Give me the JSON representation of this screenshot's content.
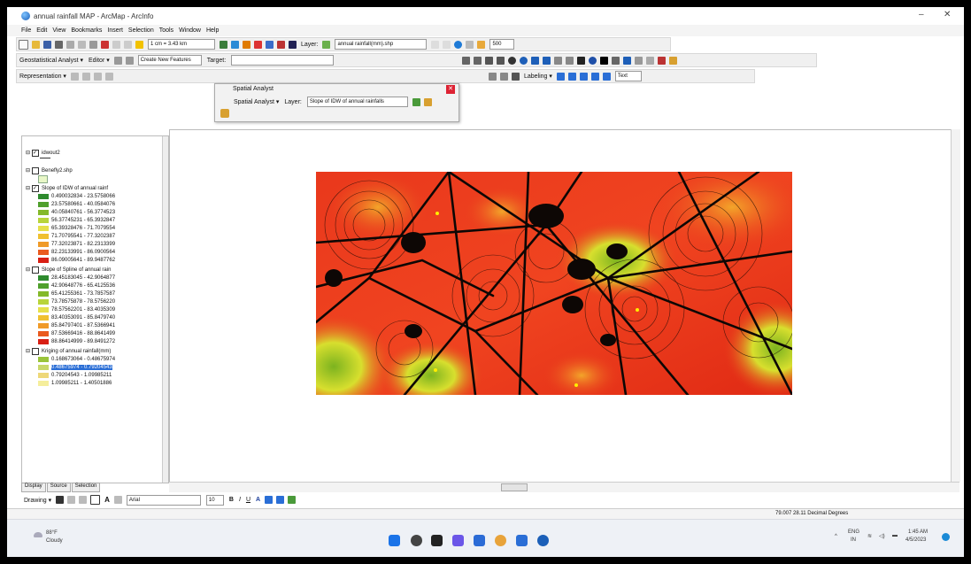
{
  "window": {
    "title": "annual rainfall MAP - ArcMap - ArcInfo",
    "minimize": "–",
    "close": "✕"
  },
  "menu": [
    "File",
    "Edit",
    "View",
    "Bookmarks",
    "Insert",
    "Selection",
    "Tools",
    "Window",
    "Help"
  ],
  "toolbar1": {
    "scale": "1 cm = 3.43 km",
    "layer_label": "Layer:",
    "layer_value": "annual rainfall(mm).shp",
    "zoom_value": "500"
  },
  "toolbar2": {
    "geostat_label": "Geostatistical Analyst ▾",
    "editor_label": "Editor ▾",
    "create_features": "Create New Features",
    "target": "Target:"
  },
  "toolbar3": {
    "representation_label": "Representation ▾",
    "labeling_label": "Labeling ▾",
    "font_value": "Text"
  },
  "spatial_analyst": {
    "title": "Spatial Analyst",
    "menu_label": "Spatial Analyst ▾",
    "layer_label": "Layer:",
    "layer_value": "Slope of IDW of annual rainfalls"
  },
  "toc": {
    "layers": [
      {
        "name": "idwout2",
        "checked": true
      },
      {
        "name": "Benefly2.shp",
        "checked": false
      },
      {
        "name": "Slope of IDW of annual rainf",
        "checked": true,
        "classes": [
          "0.490032834 - 23.5758066",
          "23.57580661 - 40.0584076",
          "40.05840761 - 56.3774523",
          "56.37745231 - 65.3932847",
          "65.39328476 - 71.7079554",
          "71.70795541 - 77.3202387",
          "77.32023871 - 82.2313399",
          "82.23133991 - 86.0900564",
          "86.09005641 - 89.9487762"
        ]
      },
      {
        "name": "Slope of Spline of annual rain",
        "checked": false,
        "classes": [
          "28.45183045 - 42.9064877",
          "42.90648776 - 65.4125536",
          "65.41255361 - 73.7857587",
          "73.78575878 - 78.5756220",
          "78.57562201 - 83.4035309",
          "83.40353091 - 85.8479740",
          "85.84797401 - 87.5366941",
          "87.53669416 - 88.8641499",
          "88.86414999 - 89.8491272"
        ]
      },
      {
        "name": "Kriging of annual rainfall(mm)",
        "checked": false,
        "classes": [
          "0.168673064 - 0.48675974",
          "0.48675974 - 0.79204543",
          "0.79204543 - 1.09985211",
          "1.09985211 - 1.40501886"
        ]
      }
    ],
    "tabs": [
      "Display",
      "Source",
      "Selection"
    ]
  },
  "drawing": {
    "label": "Drawing ▾",
    "font": "Arial",
    "size": "10"
  },
  "status": {
    "coords": "79.007  28.11 Decimal Degrees"
  },
  "taskbar": {
    "weather_temp": "88°F",
    "weather_desc": "Cloudy",
    "lang": "ENG",
    "lang2": "IN",
    "time": "1:45 AM",
    "date": "4/5/2023"
  },
  "colors": {
    "accent": "#2a6ed6",
    "close": "#d22"
  }
}
